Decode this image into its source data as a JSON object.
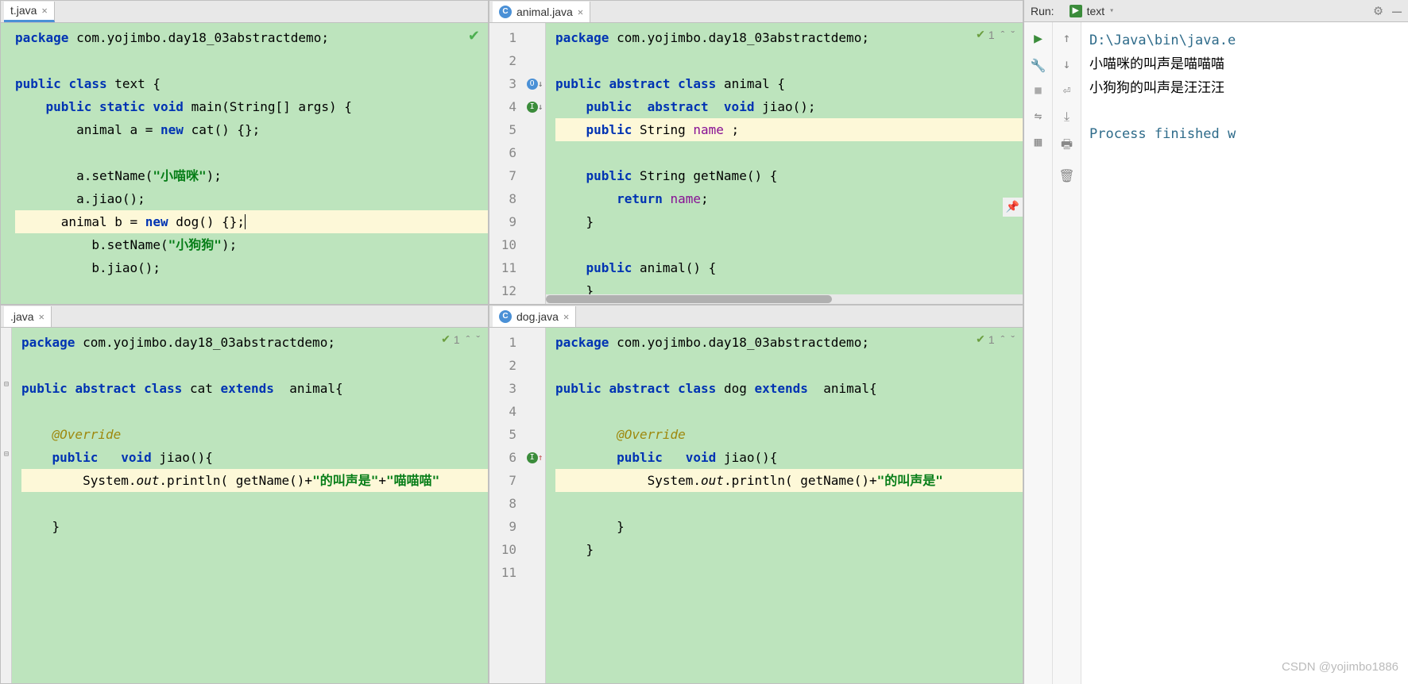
{
  "tabs": {
    "top_left": "t.java",
    "top_right": "animal.java",
    "bottom_left": ".java",
    "bottom_right": "dog.java"
  },
  "pane_tl": {
    "lines": [
      {
        "t": "package com.yojimbo.day18_03abstractdemo;",
        "hl": false
      },
      {
        "t": "",
        "hl": false
      },
      {
        "t": "public class text {",
        "hl": false
      },
      {
        "t": "    public static void main(String[] args) {",
        "hl": false
      },
      {
        "t": "        animal a = new cat() {};",
        "hl": false
      },
      {
        "t": "",
        "hl": false
      },
      {
        "t": "        a.setName(\"小喵咪\");",
        "hl": false
      },
      {
        "t": "        a.jiao();",
        "hl": false
      },
      {
        "t": "      animal b = new dog() {};",
        "hl": true,
        "cursor": true
      },
      {
        "t": "          b.setName(\"小狗狗\");",
        "hl": false
      },
      {
        "t": "          b.jiao();",
        "hl": false
      }
    ]
  },
  "pane_tr": {
    "nums": [
      "1",
      "2",
      "3",
      "4",
      "5",
      "6",
      "7",
      "8",
      "9",
      "10",
      "11",
      "12"
    ],
    "lines": [
      {
        "t": "package com.yojimbo.day18_03abstractdemo;",
        "hl": false
      },
      {
        "t": "",
        "hl": false
      },
      {
        "t": "public abstract class animal {",
        "hl": false
      },
      {
        "t": "    public  abstract  void jiao();",
        "hl": false
      },
      {
        "t": "    public String name ;",
        "hl": true
      },
      {
        "t": "",
        "hl": false
      },
      {
        "t": "    public String getName() {",
        "hl": false
      },
      {
        "t": "        return name;",
        "hl": false
      },
      {
        "t": "    }",
        "hl": false
      },
      {
        "t": "",
        "hl": false
      },
      {
        "t": "    public animal() {",
        "hl": false
      },
      {
        "t": "    }",
        "hl": false
      }
    ],
    "badge": "1"
  },
  "pane_bl": {
    "lines": [
      {
        "t": "package com.yojimbo.day18_03abstractdemo;",
        "hl": false
      },
      {
        "t": "",
        "hl": false
      },
      {
        "t": "public abstract class cat extends  animal{",
        "hl": false
      },
      {
        "t": "",
        "hl": false
      },
      {
        "t": "    @Override",
        "hl": false,
        "ov": true
      },
      {
        "t": "    public   void jiao(){",
        "hl": false
      },
      {
        "t": "        System.out.println( getName()+\"的叫声是\"+\"喵喵喵\"",
        "hl": true
      },
      {
        "t": "",
        "hl": false
      },
      {
        "t": "    }",
        "hl": false
      }
    ],
    "badge": "1"
  },
  "pane_br": {
    "nums": [
      "1",
      "2",
      "3",
      "4",
      "5",
      "6",
      "7",
      "8",
      "9",
      "10",
      "11"
    ],
    "lines": [
      {
        "t": "package com.yojimbo.day18_03abstractdemo;",
        "hl": false
      },
      {
        "t": "",
        "hl": false
      },
      {
        "t": "public abstract class dog extends  animal{",
        "hl": false
      },
      {
        "t": "",
        "hl": false
      },
      {
        "t": "        @Override",
        "hl": false,
        "ov": true
      },
      {
        "t": "        public   void jiao(){",
        "hl": false
      },
      {
        "t": "            System.out.println( getName()+\"的叫声是\"",
        "hl": true
      },
      {
        "t": "",
        "hl": false
      },
      {
        "t": "        }",
        "hl": false
      },
      {
        "t": "    }",
        "hl": false
      },
      {
        "t": "",
        "hl": false
      }
    ],
    "badge": "1"
  },
  "run": {
    "label": "Run:",
    "config": "text",
    "console": {
      "path": "D:\\Java\\bin\\java.e",
      "line1": "小喵咪的叫声是喵喵喵",
      "line2": "小狗狗的叫声是汪汪汪",
      "finished": "Process finished w"
    }
  },
  "watermark": "CSDN @yojimbo1886"
}
